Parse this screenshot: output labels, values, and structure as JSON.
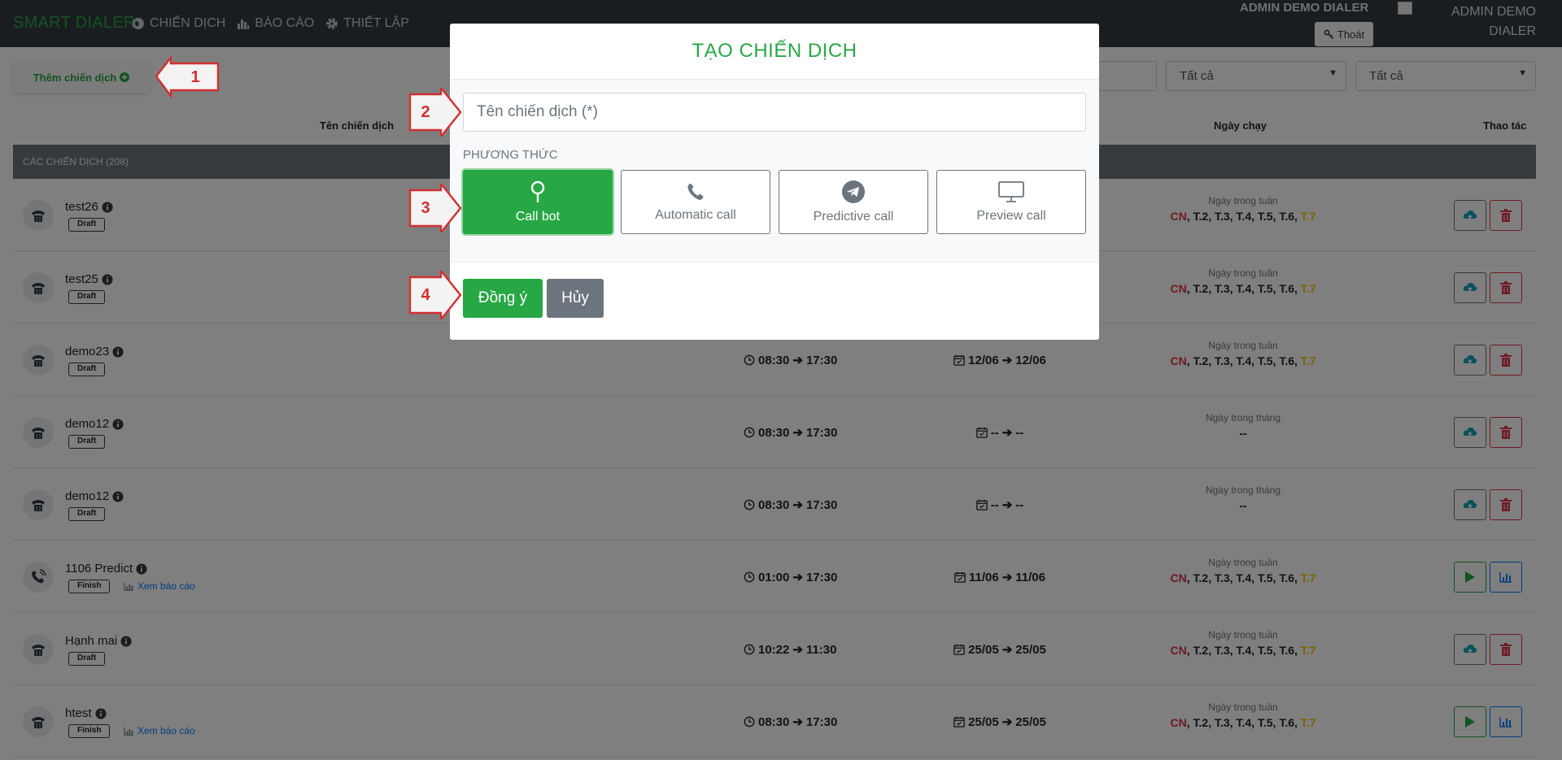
{
  "navbar": {
    "brand": "SMART DIALER",
    "items": [
      {
        "label": "CHIẾN DỊCH",
        "icon": "globe-icon"
      },
      {
        "label": "BÁO CÁO",
        "icon": "bar-chart-icon"
      },
      {
        "label": "THIẾT LẬP",
        "icon": "gear-icon"
      }
    ],
    "user_name": "ADMIN DEMO DIALER",
    "logout_label": "Thoát",
    "user_name_2_line1": "ADMIN DEMO",
    "user_name_2_line2": "DIALER"
  },
  "toolbar": {
    "add_label": "Thêm chiến dịch",
    "filter_1": "Tất cả",
    "filter_2": "Tất cả"
  },
  "table": {
    "headers": {
      "name": "Tên chiến dịch",
      "run_day": "Ngày chạy",
      "actions": "Thao tác"
    },
    "group_label": "CÁC CHIẾN DỊCH (208)",
    "days": {
      "sun": "CN",
      "weekdays": ", T.2, T.3, T.4, T.5, T.6, ",
      "sat": "T.7"
    },
    "rows": [
      {
        "name": "test26",
        "status": "Draft",
        "time_start": "",
        "time_end": "",
        "date_start": "",
        "date_end": "",
        "day_label": "Ngày trong tuần",
        "month_value": ""
      },
      {
        "name": "test25",
        "status": "Draft",
        "time_start": "",
        "time_end": "",
        "date_start": "",
        "date_end": "",
        "day_label": "Ngày trong tuần",
        "month_value": ""
      },
      {
        "name": "demo23",
        "status": "Draft",
        "time_start": "08:30",
        "time_end": "17:30",
        "date_start": "12/06",
        "date_end": "12/06",
        "day_label": "Ngày trong tuần",
        "month_value": ""
      },
      {
        "name": "demo12",
        "status": "Draft",
        "time_start": "08:30",
        "time_end": "17:30",
        "date_start": "--",
        "date_end": "--",
        "day_label": "Ngày trong tháng",
        "month_value": "--"
      },
      {
        "name": "demo12",
        "status": "Draft",
        "time_start": "08:30",
        "time_end": "17:30",
        "date_start": "--",
        "date_end": "--",
        "day_label": "Ngày trong tháng",
        "month_value": "--"
      },
      {
        "name": "1106 Predict",
        "status": "Finish",
        "report_link": "Xem báo cáo",
        "time_start": "01:00",
        "time_end": "17:30",
        "date_start": "11/06",
        "date_end": "11/06",
        "day_label": "Ngày trong tuần",
        "month_value": ""
      },
      {
        "name": "Hạnh mai",
        "status": "Draft",
        "time_start": "10:22",
        "time_end": "11:30",
        "date_start": "25/05",
        "date_end": "25/05",
        "day_label": "Ngày trong tuần",
        "month_value": ""
      },
      {
        "name": "htest",
        "status": "Finish",
        "report_link": "Xem báo cáo",
        "time_start": "08:30",
        "time_end": "17:30",
        "date_start": "25/05",
        "date_end": "25/05",
        "day_label": "Ngày trong tuần",
        "month_value": ""
      }
    ]
  },
  "modal": {
    "title": "TẠO CHIẾN DỊCH",
    "name_placeholder": "Tên chiến dịch (*)",
    "method_label": "PHƯƠNG THỨC",
    "methods": [
      {
        "label": "Call bot",
        "icon": "map-pin-icon",
        "active": true
      },
      {
        "label": "Automatic call",
        "icon": "phone-icon",
        "active": false
      },
      {
        "label": "Predictive call",
        "icon": "telegram-icon",
        "active": false
      },
      {
        "label": "Preview call",
        "icon": "monitor-icon",
        "active": false
      }
    ],
    "ok_label": "Đồng ý",
    "cancel_label": "Hủy"
  },
  "callouts": [
    "1",
    "2",
    "3",
    "4"
  ],
  "colors": {
    "brand_green": "#28a745",
    "navbar_bg": "#343a40",
    "danger": "#dc3545",
    "warning": "#ffc107",
    "callout_red": "#d32f2f"
  }
}
